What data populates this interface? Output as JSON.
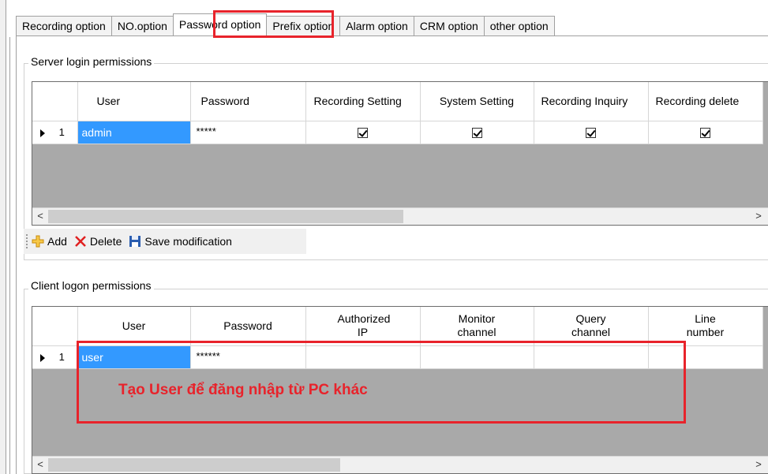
{
  "tabs": [
    "Recording option",
    "NO.option",
    "Password option",
    "Prefix option",
    "Alarm option",
    "CRM option",
    "other option"
  ],
  "server_group": {
    "title": "Server login permissions",
    "columns": [
      "User",
      "Password",
      "Recording Setting",
      "System Setting",
      "Recording Inquiry",
      "Recording delete"
    ],
    "rows": [
      {
        "num": "1",
        "user": "admin",
        "password": "*****",
        "recording_setting": true,
        "system_setting": true,
        "recording_inquiry": true,
        "recording_delete": true
      }
    ]
  },
  "toolbar": {
    "add_label": "Add",
    "delete_label": "Delete",
    "save_label": "Save modification"
  },
  "client_group": {
    "title": "Client logon permissions",
    "columns": [
      "User",
      "Password",
      "Authorized IP",
      "Monitor channel",
      "Query channel",
      "Line number"
    ],
    "rows": [
      {
        "num": "1",
        "user": "user",
        "password": "******",
        "authorized_ip": "",
        "monitor_channel": "",
        "query_channel": "",
        "line_number": ""
      }
    ]
  },
  "annotation": {
    "callout_text": "Tạo User để đăng nhập từ PC khác",
    "highlight_color": "#e8232b"
  },
  "icons": {
    "add": "plus-icon",
    "delete": "x-icon",
    "save": "floppy-icon",
    "row_pointer": "triangle-right-icon",
    "scroll_left": "chevron-left-icon",
    "scroll_right": "chevron-right-icon"
  }
}
